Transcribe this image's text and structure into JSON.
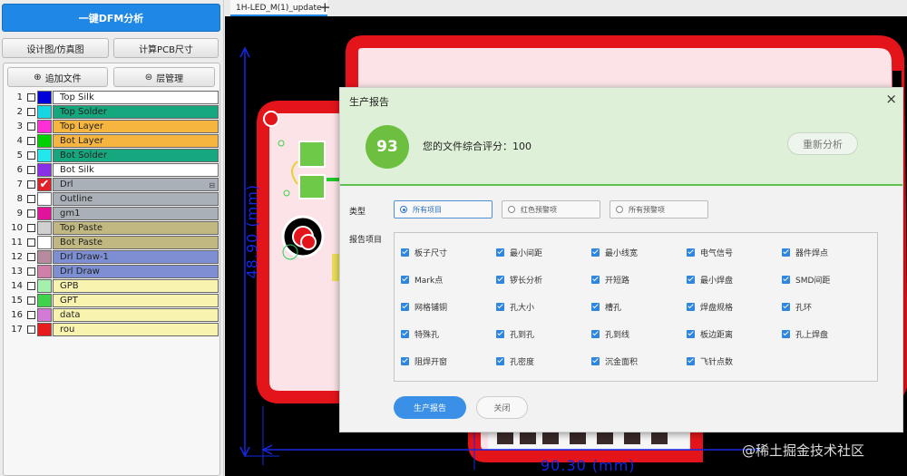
{
  "left_panel": {
    "dfm_button": "一键DFM分析",
    "design_view_button": "设计图/仿真图",
    "calc_pcb_button": "计算PCB尺寸",
    "add_file_button": "追加文件",
    "layer_manage_button": "层管理",
    "layers": [
      {
        "num": "1",
        "name": "Top Silk",
        "color": "#0000d8",
        "bg": "#ffffff",
        "checked": false
      },
      {
        "num": "2",
        "name": "Top Solder",
        "color": "#16d6e4",
        "bg": "#17a77e",
        "checked": false
      },
      {
        "num": "3",
        "name": "Top Layer",
        "color": "#ff2fd8",
        "bg": "#f5b53f",
        "checked": false
      },
      {
        "num": "4",
        "name": "Bot Layer",
        "color": "#00d000",
        "bg": "#f5b53f",
        "checked": false
      },
      {
        "num": "5",
        "name": "Bot Solder",
        "color": "#22e8ec",
        "bg": "#17a77e",
        "checked": false
      },
      {
        "num": "6",
        "name": "Bot Silk",
        "color": "#8a2fe8",
        "bg": "#ffffff",
        "checked": false
      },
      {
        "num": "7",
        "name": "Drl",
        "color": "#e0202a",
        "bg": "#aab0b8",
        "checked": true,
        "extra": "⊟"
      },
      {
        "num": "8",
        "name": "Outline",
        "color": "#ffffff",
        "bg": "#aab0b8",
        "checked": false
      },
      {
        "num": "9",
        "name": "gm1",
        "color": "#e0139a",
        "bg": "#aab0b8",
        "checked": false
      },
      {
        "num": "10",
        "name": "Top Paste",
        "color": "#d0d0d0",
        "bg": "#c0b880",
        "checked": false
      },
      {
        "num": "11",
        "name": "Bot Paste",
        "color": "#ffffff",
        "bg": "#c0b880",
        "checked": false
      },
      {
        "num": "12",
        "name": "Drl Draw-1",
        "color": "#b88aa0",
        "bg": "#7d8fd2",
        "checked": false
      },
      {
        "num": "13",
        "name": "Drl Draw",
        "color": "#d080a8",
        "bg": "#7d8fd2",
        "checked": false
      },
      {
        "num": "14",
        "name": "GPB",
        "color": "#a6f0ae",
        "bg": "#f8f4b0",
        "checked": false
      },
      {
        "num": "15",
        "name": "GPT",
        "color": "#3fd24a",
        "bg": "#f8f4b0",
        "checked": false
      },
      {
        "num": "16",
        "name": "data",
        "color": "#d37ad6",
        "bg": "#f8f4b0",
        "checked": false
      },
      {
        "num": "17",
        "name": "rou",
        "color": "#e81c1c",
        "bg": "#f8f4b0",
        "checked": false
      }
    ]
  },
  "tabs": {
    "active": "1H-LED_M(1)_update",
    "add_icon": "+"
  },
  "canvas": {
    "dimension_x": "90.30 (mm)",
    "dimension_y": "48.90 (mm)"
  },
  "dialog": {
    "title": "生产报告",
    "close_icon": "×",
    "score": "93",
    "score_text": "您的文件综合评分：100",
    "reanalyze_button": "重新分析",
    "type_label": "类型",
    "type_options": [
      "所有项目",
      "红色预警项",
      "所有预警项"
    ],
    "selected_type": "所有项目",
    "items_label": "报告项目",
    "items": [
      "板子尺寸",
      "最小间距",
      "最小线宽",
      "电气信号",
      "器件焊点",
      "Mark点",
      "锣长分析",
      "开短路",
      "最小焊盘",
      "SMD间距",
      "网格铺铜",
      "孔大小",
      "槽孔",
      "焊盘规格",
      "孔环",
      "特殊孔",
      "孔到孔",
      "孔到线",
      "板边距离",
      "孔上焊盘",
      "阻焊开窗",
      "孔密度",
      "沉金面积",
      "飞针点数"
    ],
    "generate_button": "生产报告",
    "close_button": "关闭"
  },
  "watermark": "@稀土掘金技术社区",
  "colors": {
    "primary_blue": "#1f87e5",
    "score_green": "#6cbf3f",
    "header_green": "#def0d7",
    "board_red": "#e3151b",
    "board_pink": "#fbe3e7",
    "dimension_blue": "#1428e6"
  }
}
